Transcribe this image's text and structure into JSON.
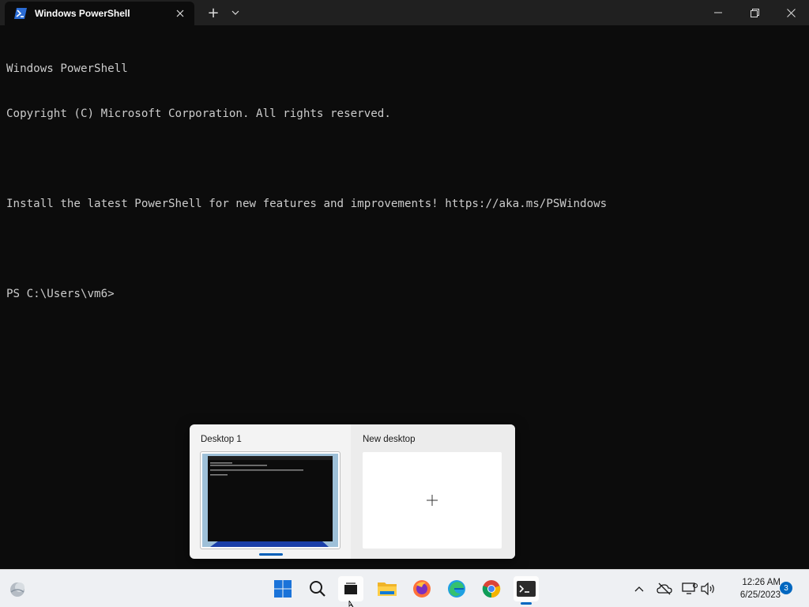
{
  "window": {
    "tab_title": "Windows PowerShell",
    "new_tab_symbol": "+",
    "dropdown_symbol": "⌄"
  },
  "terminal": {
    "lines": [
      "Windows PowerShell",
      "Copyright (C) Microsoft Corporation. All rights reserved.",
      "",
      "Install the latest PowerShell for new features and improvements! https://aka.ms/PSWindows",
      "",
      "PS C:\\Users\\vm6>"
    ]
  },
  "task_view": {
    "desktops": [
      {
        "label": "Desktop 1",
        "active": true
      },
      {
        "label": "New desktop",
        "active": false
      }
    ]
  },
  "taskbar": {
    "apps": [
      {
        "name": "start-button-icon"
      },
      {
        "name": "search-icon"
      },
      {
        "name": "task-view-icon",
        "active": true
      },
      {
        "name": "file-explorer-icon"
      },
      {
        "name": "firefox-icon"
      },
      {
        "name": "edge-icon"
      },
      {
        "name": "chrome-icon"
      },
      {
        "name": "terminal-icon",
        "running": true
      }
    ],
    "clock": {
      "time": "12:26 AM",
      "date": "6/25/2023"
    },
    "notification_count": "3"
  },
  "colors": {
    "terminal_bg": "#0c0c0c",
    "terminal_fg": "#cccccc",
    "accent": "#0067c0"
  }
}
